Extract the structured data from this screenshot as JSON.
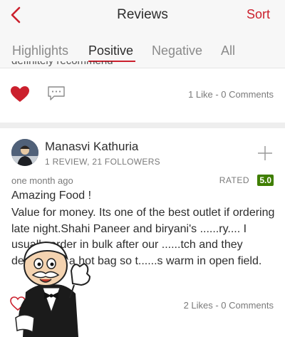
{
  "nav": {
    "title": "Reviews",
    "sort_label": "Sort"
  },
  "tabs": [
    {
      "label": "Highlights"
    },
    {
      "label": "Positive"
    },
    {
      "label": "Negative"
    },
    {
      "label": "All"
    }
  ],
  "previous_review": {
    "cut_text": "definitely recommend",
    "likes_text": "1 Like - 0 Comments"
  },
  "review": {
    "author": "Manasvi Kathuria",
    "author_meta": "1 REVIEW, 21 FOLLOWERS",
    "time": "one month ago",
    "rated_label": "RATED",
    "rating": "5.0",
    "title": "Amazing Food !",
    "body": "Value for money. Its one of the best outlet if ordering late night.Shahi Paneer and biryani's ......ry.... I usually order in bulk after our ......tch and they deliver it in a hot bag so t......s warm in open field.",
    "likes_text": "2 Likes - 0 Comments"
  },
  "colors": {
    "accent": "#cb202d",
    "rating_green": "#3f7e00"
  },
  "icons": {
    "back": "chevron-left-icon",
    "heart": "heart-icon",
    "comment": "comment-icon",
    "follow": "plus-icon"
  }
}
